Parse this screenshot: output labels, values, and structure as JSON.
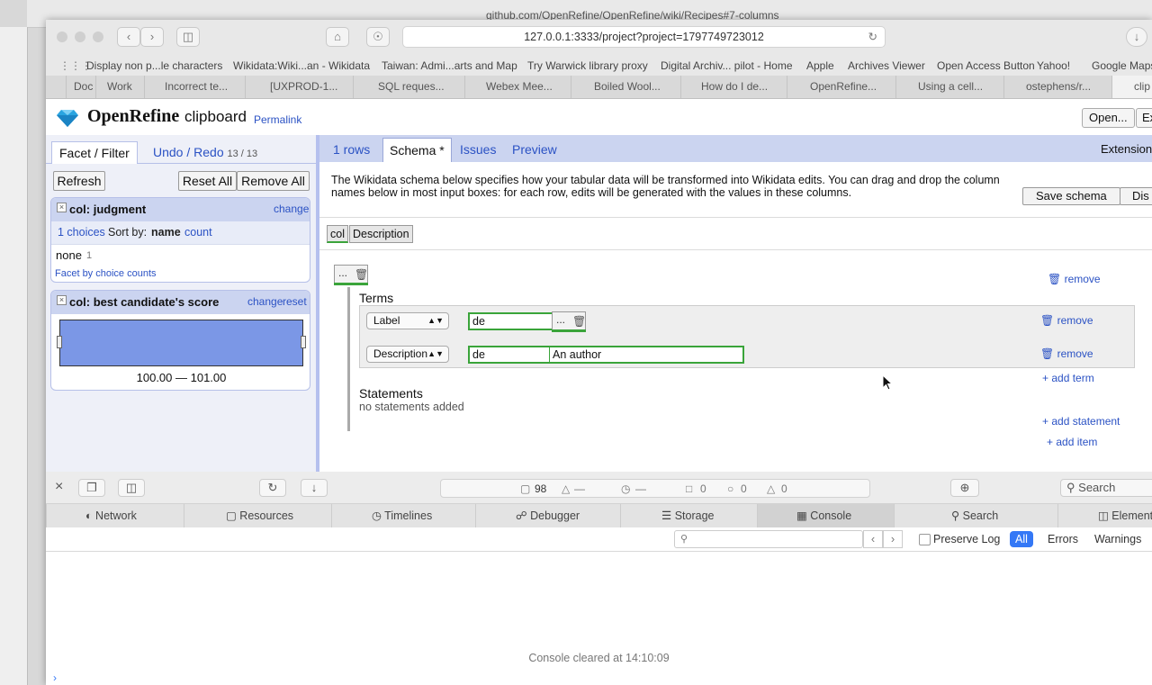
{
  "background_window": {
    "url": "github.com/OpenRefine/OpenRefine/wiki/Recipes#7-columns"
  },
  "browser": {
    "url": "127.0.0.1:3333/project?project=1797749723012",
    "bookmarks": [
      "Display non p...le characters",
      "Wikidata:Wiki...an - Wikidata",
      "Taiwan: Admi...arts and Map",
      "Try Warwick library proxy",
      "Digital Archiv... pilot - Home",
      "Apple",
      "Archives Viewer",
      "Open Access Button",
      "Yahoo!",
      "Google Maps"
    ],
    "tabs": [
      "Doc",
      "Work",
      "Incorrect te...",
      "[UXPROD-1...",
      "SQL reques...",
      "Webex Mee...",
      "Boiled Wool...",
      "How do I de...",
      "OpenRefine...",
      "Using a cell...",
      "ostephens/r...",
      "clip"
    ]
  },
  "app": {
    "logo": "OpenRefine",
    "project_name": "clipboard",
    "permalink": "Permalink",
    "open_button": "Open...",
    "export_button": "Ex",
    "extensions": "Extension"
  },
  "left_panel": {
    "tab_facet": "Facet / Filter",
    "tab_undo": "Undo / Redo",
    "undo_count": "13 / 13",
    "refresh": "Refresh",
    "reset_all": "Reset All",
    "remove_all": "Remove All",
    "facet1": {
      "title": "col: judgment",
      "change": "change",
      "choices": "1 choices",
      "sort_by": "Sort by:",
      "sort_name": "name",
      "sort_count": "count",
      "item": "none",
      "item_count": "1",
      "facet_by_counts": "Facet by choice counts"
    },
    "facet2": {
      "title": "col: best candidate's score",
      "change": "change",
      "reset": "reset",
      "range": "100.00 — 101.00"
    }
  },
  "right_panel": {
    "tabs": [
      "1 rows",
      "Schema *",
      "Issues",
      "Preview"
    ],
    "description": "The Wikidata schema below specifies how your tabular data will be transformed into Wikidata edits. You can drag and drop the column names below in most input boxes: for each row, edits will be generated with the values in these columns.",
    "save_schema": "Save schema",
    "discard": "Dis",
    "columns": [
      "col",
      "Description"
    ],
    "ellipsis": "...",
    "remove": "remove",
    "terms_heading": "Terms",
    "term1": {
      "type": "Label",
      "lang": "de"
    },
    "term2": {
      "type": "Description",
      "lang": "de",
      "value": "An author"
    },
    "add_term": "+ add term",
    "statements_heading": "Statements",
    "no_statements": "no statements added",
    "add_statement": "+ add statement",
    "add_item": "+ add item"
  },
  "devtools": {
    "resource_count": "98",
    "dash1": "—",
    "dash2": "—",
    "count_log": "0",
    "count_error": "0",
    "count_warn": "0",
    "search_placeholder": "Search",
    "tabs": [
      "Network",
      "Resources",
      "Timelines",
      "Debugger",
      "Storage",
      "Console",
      "Search",
      "Elements"
    ],
    "preserve_log": "Preserve Log",
    "filter_all": "All",
    "filter_errors": "Errors",
    "filter_warnings": "Warnings",
    "console_cleared": "Console cleared at 14:10:09"
  }
}
